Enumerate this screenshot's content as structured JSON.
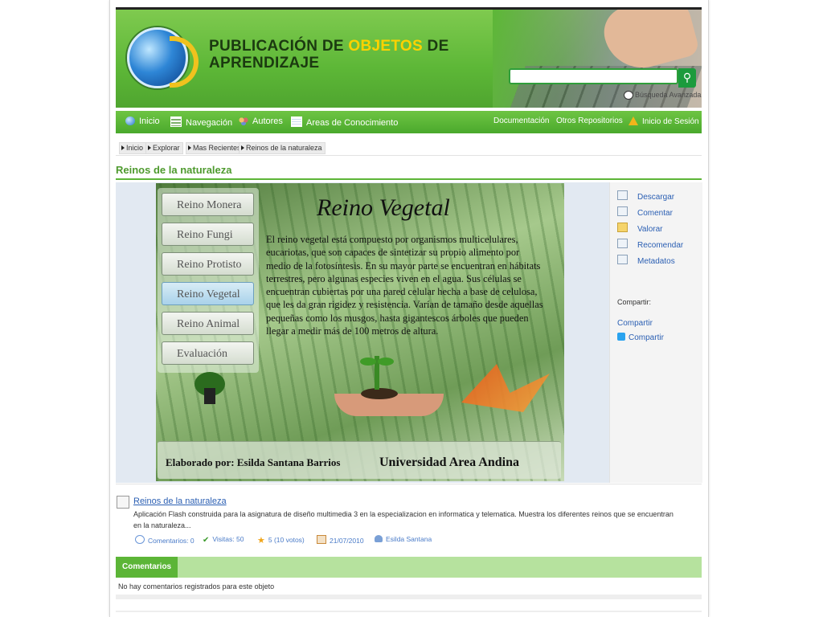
{
  "header": {
    "title_part1": "PUBLICACIÓN DE ",
    "title_highlight": "OBJETOS",
    "title_part2": " DE",
    "title_line2": "APRENDIZAJE",
    "search_placeholder": "",
    "advanced_search": "Búsqueda Avanzada"
  },
  "nav": {
    "left": [
      "Inicio",
      "Navegación",
      "Autores",
      "Areas de Conocimiento"
    ],
    "right": [
      "Documentación",
      "Otros Repositorios",
      "Inicio de Sesión"
    ]
  },
  "breadcrumb": [
    "Inicio",
    "Explorar",
    "Mas Recientes",
    "Reinos de la naturaleza"
  ],
  "page_title": "Reinos de la naturaleza",
  "flash": {
    "menu": [
      "Reino Monera",
      "Reino Fungi",
      "Reino Protisto",
      "Reino Vegetal",
      "Reino Animal",
      "Evaluación"
    ],
    "selected_index": 3,
    "heading": "Reino Vegetal",
    "body": "El reino vegetal está compuesto por organismos multicelulares, eucariotas, que son capaces de sintetizar su propio alimento por medio de la fotosíntesis. En su mayor parte se encuentran en hábitats terrestres, pero algunas especies viven en el agua. Sus células se encuentran cubiertas por una pared celular hecha a base de celulosa, que les da gran rigidez y resistencia. Varían de tamaño desde aquellas pequeñas como los musgos, hasta gigantescos árboles que pueden llegar a medir más de 100 metros de altura.",
    "credit": "Elaborado por: Esilda Santana Barrios",
    "university": "Universidad Area Andina"
  },
  "actions": [
    "Descargar",
    "Comentar",
    "Valorar",
    "Recomendar",
    "Metadatos"
  ],
  "share": {
    "label": "Compartir:",
    "link": "Compartir",
    "twitter": "Compartir"
  },
  "object": {
    "title": "Reinos de la naturaleza",
    "description": "Aplicación Flash construida para la asignatura de diseño multimedia 3 en la especializacion en informatica y telematica. Muestra los diferentes reinos que se encuentran en la naturaleza...",
    "comments": "Comentarios: 0",
    "visits": "Visitas: 50",
    "rating": "5 (10 votos)",
    "date": "21/07/2010",
    "author": "Esilda Santana"
  },
  "comments": {
    "tab": "Comentarios",
    "empty": "No hay comentarios registrados para este objeto"
  },
  "colors": {
    "brand_green": "#5cb537",
    "link_blue": "#2b5fb3",
    "highlight_yellow": "#ffd200"
  }
}
